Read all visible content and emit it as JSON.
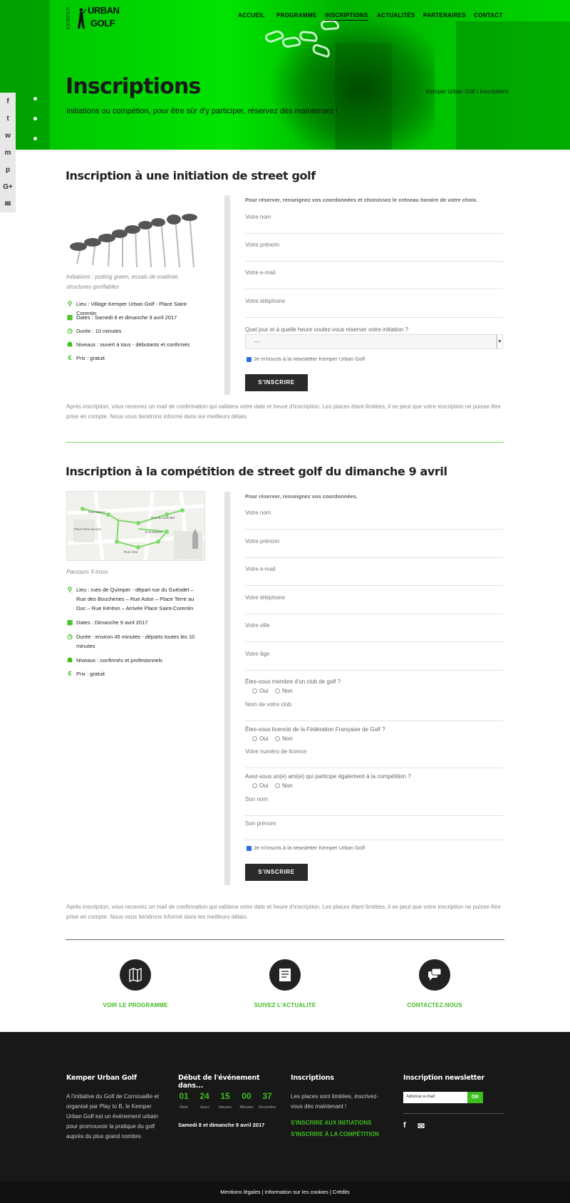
{
  "brand": {
    "side": "KEMPER",
    "line1": "URBAN",
    "line2": "GOLF"
  },
  "nav": [
    "ACCUEIL",
    "PROGRAMME",
    "INSCRIPTIONS",
    "ACTUALITÉS",
    "PARTENAIRES",
    "CONTACT"
  ],
  "hero": {
    "title": "Inscriptions",
    "subtitle": "Initiations ou compétion, pour être sûr d'y participer, réservez dès maintenant !",
    "breadcrumb": "Kemper Urban Golf / Inscriptions"
  },
  "share_icons": [
    "facebook-icon",
    "twitter-icon",
    "whatsapp-icon",
    "messenger-icon",
    "pinterest-icon",
    "google-plus-icon",
    "email-icon"
  ],
  "share_glyphs": [
    "f",
    "t",
    "w",
    "m",
    "p",
    "G+",
    "✉"
  ],
  "initiation": {
    "title": "Inscription à une initiation de street golf",
    "caption": "Initiations : putting green, essais de matériel, structures gonflables",
    "info": [
      {
        "icon": "location-icon",
        "glyph": "⚲",
        "text": "Lieu : Village Kemper Urban Golf - Place Saint-Corentin"
      },
      {
        "icon": "calendar-icon",
        "glyph": "▦",
        "text": "Dates : Samedi 8 et dimanche 9 avril 2017"
      },
      {
        "icon": "clock-icon",
        "glyph": "◷",
        "text": "Durée : 10 minutes"
      },
      {
        "icon": "people-icon",
        "glyph": "☗",
        "text": "Niveaux : ouvert à tous - débutants et confirmés"
      },
      {
        "icon": "euro-icon",
        "glyph": "€",
        "text": "Prix : gratuit"
      }
    ],
    "form": {
      "lead": "Pour réserver, renseignez vos coordonnées et choisissez le créneau horaire de votre choix.",
      "fields": [
        "Votre nom",
        "Votre prénom",
        "Votre e-mail",
        "Votre téléphone"
      ],
      "slot_question": "Quel jour et à quelle heure voulez-vous réserver votre initiation ?",
      "slot_value": "---",
      "newsletter": "Je m'inscris à la newsletter Kemper Urban Golf",
      "submit": "S'INSCRIRE"
    },
    "note": "Après inscription, vous recevrez un mail de confirmation qui validera votre date et heure d'inscription. Les places étant limitées, il se peut que votre inscription ne puisse être prise en compte. Nous vous tiendrons informé dans les meilleurs délais."
  },
  "competition": {
    "title": "Inscription à la compétition de street golf du dimanche 9 avril",
    "map_labels": [
      "Rue Kéréon",
      "Rue du Guéodet",
      "Place Terre au Duc",
      "Rue Kéréon",
      "Rue Astor"
    ],
    "caption": "Parcours 9 trous",
    "info": [
      {
        "icon": "location-icon",
        "glyph": "⚲",
        "text": "Lieu : rues de Quimper - départ rue du Guéodet – Rue des Boucheries – Rue Astor – Place Terre au Duc – Rue Kéréon – Arrivée Place Saint-Corentin"
      },
      {
        "icon": "calendar-icon",
        "glyph": "▦",
        "text": "Dates : Dimanche 9 avril 2017"
      },
      {
        "icon": "clock-icon",
        "glyph": "◷",
        "text": "Durée : environ 45 minutes - départs toutes les 10 minutes"
      },
      {
        "icon": "people-icon",
        "glyph": "☗",
        "text": "Niveaux : confirmés et profesionnels"
      },
      {
        "icon": "euro-icon",
        "glyph": "€",
        "text": "Prix : gratuit"
      }
    ],
    "form": {
      "lead": "Pour réserver, renseignez vos coordonnées.",
      "fields": [
        "Votre nom",
        "Votre prénom",
        "Votre e-mail",
        "Votre téléphone",
        "Votre ville",
        "Votre âge"
      ],
      "q_club": "Êtes-vous membre d'un club de golf ?",
      "club_field": "Nom de votre club",
      "q_licence": "Êtes-vous licencié de la Fédération Française de Golf ?",
      "licence_field": "Votre numéro de licence",
      "q_friend": "Avez-vous un(e) ami(e) qui participe également à la compétition ?",
      "friend_name": "Son nom",
      "friend_firstname": "Son prénom",
      "yes": "Oui",
      "no": "Non",
      "newsletter": "Je m'inscris à la newsletter Kemper Urban Golf",
      "submit": "S'INSCRIRE"
    },
    "note": "Après inscription, vous recevrez un mail de confirmation qui validera votre date et heure d'inscription. Les places étant limitées, il se peut que votre inscription ne puisse être prise en compte. Nous vous tiendrons informé dans les meilleurs délais."
  },
  "features": [
    {
      "icon": "map-icon",
      "label": "VOIR LE PROGRAMME"
    },
    {
      "icon": "news-icon",
      "label": "SUIVEZ L'ACTUALITE"
    },
    {
      "icon": "chat-icon",
      "label": "CONTACTEZ-NOUS"
    }
  ],
  "footer": {
    "about_title": "Kemper Urban Golf",
    "about_text": "A l'initiative du Golf de Cornouaille et organisé par Play to B, le Kemper Urban Golf est un événement urbain pour promouvoir la pratique du golf auprès du plus grand nombre.",
    "countdown_title": "Début de l'événement dans...",
    "countdown": [
      {
        "value": "01",
        "unit": "Mois"
      },
      {
        "value": "24",
        "unit": "Jours"
      },
      {
        "value": "15",
        "unit": "Heures"
      },
      {
        "value": "00",
        "unit": "Minutes"
      },
      {
        "value": "37",
        "unit": "Secondes"
      }
    ],
    "event_dates": "Samedi 8 et dimanche 9 avril 2017",
    "insc_title": "Inscriptions",
    "insc_text": "Les places sont limitées, inscrivez-vous dès maintenant !",
    "insc_link1": "S'INSCRIRE AUX INITIATIONS",
    "insc_link2": "S'INSCRIRE À LA COMPÉTITION",
    "nl_title": "Inscription newsletter",
    "nl_placeholder": "Adresse e-mail",
    "nl_button": "OK",
    "bottom": "Mentions légales | Information sur les cookies | Crédits"
  },
  "colors": {
    "accent": "#3dbd1e",
    "hero": "#00e600",
    "footer": "#181818",
    "button": "#2a2a2a"
  }
}
